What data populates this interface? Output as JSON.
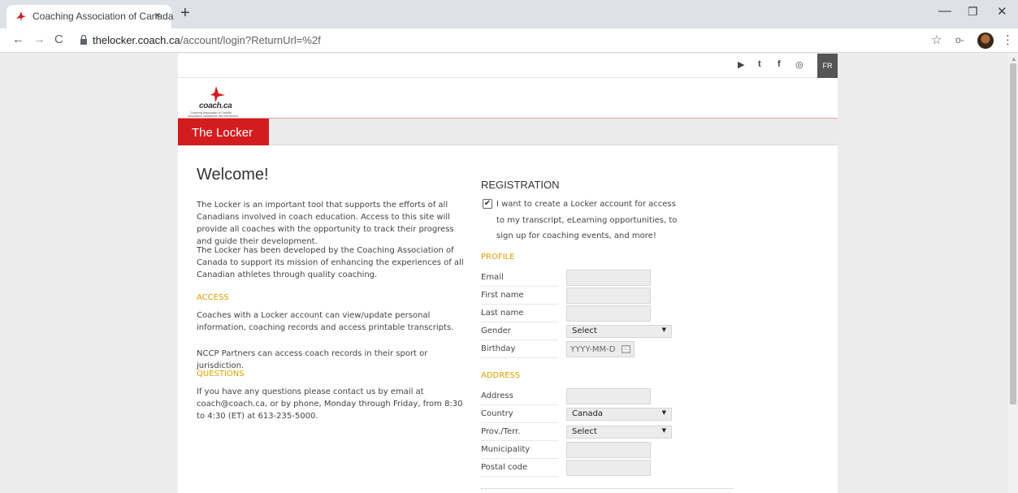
{
  "browser": {
    "tab_title": "Coaching Association of Canada",
    "tab_close": "×",
    "new_tab": "+",
    "url_host": "thelocker.coach.ca",
    "url_path": "/account/login?ReturnUrl=%2f",
    "icons": {
      "back": "←",
      "forward": "→",
      "reload": "C",
      "star": "☆",
      "key": "o‑",
      "menu": "⋮",
      "minimize": "—",
      "maximize": "❐",
      "close": "✕"
    }
  },
  "header": {
    "social": {
      "youtube": "▶",
      "twitter": "t",
      "facebook": "f",
      "instagram": "◎"
    },
    "lang_button": "FR",
    "logo_text": "coach.ca",
    "logo_sub1": "Coaching Association of Canada",
    "logo_sub2": "Association canadienne des entraîneurs",
    "section_title": "The Locker"
  },
  "left": {
    "welcome": "Welcome!",
    "p1": "The Locker is an important tool that supports the efforts of all Canadians involved in coach education. Access to this site will provide all coaches with the opportunity to track their progress and guide their development.",
    "p2": "The Locker has been developed by the Coaching Association of Canada to support its mission of enhancing the experiences of all Canadian athletes through quality coaching.",
    "access_heading": "ACCESS",
    "p3": "Coaches with a Locker account can view/update personal information, coaching records and access printable transcripts.",
    "p4": "NCCP Partners can access coach records in their sport or jurisdiction.",
    "questions_heading": "QUESTIONS",
    "p5": "If you have any questions please contact us by email at coach@coach.ca, or by phone, Monday through Friday, from 8:30 to 4:30 (ET) at 613-235-5000."
  },
  "registration": {
    "title": "REGISTRATION",
    "checkbox_mark": "✔",
    "checkbox_text": "I want to create a Locker account for access to my transcript, eLearning opportunities, to sign up for coaching events, and more!",
    "profile_heading": "PROFILE",
    "email_label": "Email",
    "first_name_label": "First name",
    "last_name_label": "Last name",
    "gender_label": "Gender",
    "gender_value": "Select",
    "birthday_label": "Birthday",
    "birthday_placeholder": "YYYY-MM-D",
    "address_heading": "ADDRESS",
    "address_label": "Address",
    "country_label": "Country",
    "country_value": "Canada",
    "prov_label": "Prov./Terr.",
    "prov_value": "Select",
    "municipality_label": "Municipality",
    "postal_label": "Postal code",
    "select_arrow": "▼"
  }
}
